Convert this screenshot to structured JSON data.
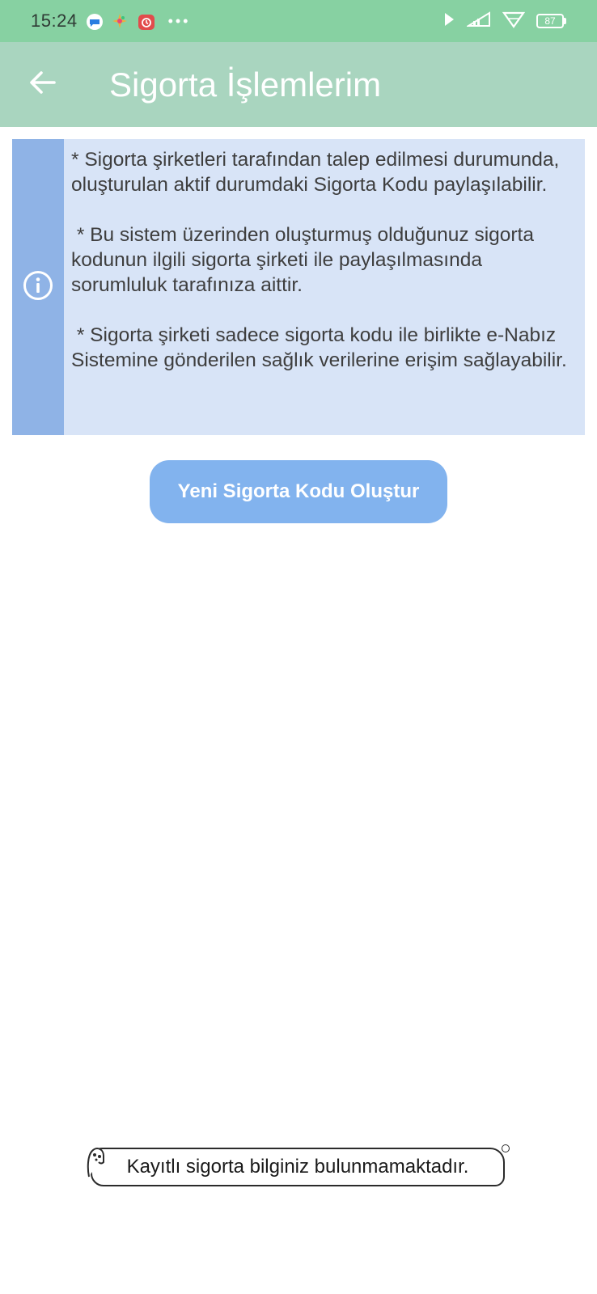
{
  "status_bar": {
    "time": "15:24",
    "battery": "87",
    "icons_left": [
      "message-icon",
      "app-icon",
      "calendar-icon",
      "more-dots-icon"
    ],
    "icons_right": [
      "signal-app-icon",
      "network-icon",
      "wifi-icon",
      "battery-icon"
    ]
  },
  "header": {
    "title": "Sigorta İşlemlerim",
    "back_icon": "arrow-left-icon"
  },
  "info": {
    "icon": "info-icon",
    "paragraphs": [
      "* Sigorta şirketleri tarafından talep edilmesi durumunda, oluşturulan aktif durumdaki Sigorta Kodu paylaşılabilir.",
      " * Bu sistem üzerinden oluşturmuş olduğunuz sigorta kodunun ilgili sigorta şirketi ile paylaşılmasında sorumluluk tarafınıza aittir.",
      " * Sigorta şirketi sadece sigorta kodu ile birlikte e-Nabız Sistemine gönderilen sağlık verilerine erişim sağlayabilir."
    ]
  },
  "actions": {
    "new_code_label": "Yeni Sigorta Kodu Oluştur"
  },
  "toast": {
    "message": "Kayıtlı sigorta bilginiz bulunmamaktadır."
  },
  "colors": {
    "status_bar": "#87d1a2",
    "app_bar": "#a9d5bf",
    "info_bg": "#d8e4f7",
    "info_strip": "#8fb3e6",
    "button": "#82b3ee"
  }
}
